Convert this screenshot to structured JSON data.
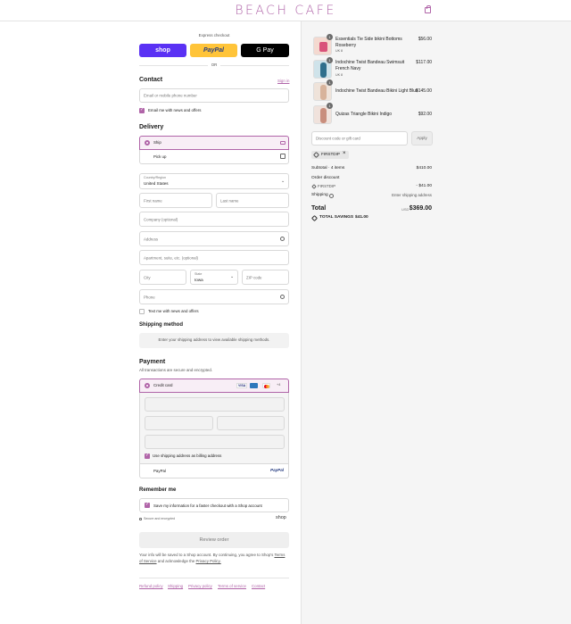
{
  "header": {
    "brand": "BEACH CAFE",
    "cart_icon": "shopping-bag-icon"
  },
  "express": {
    "label": "Express checkout",
    "shop_label": "shop",
    "paypal_label": "PayPal",
    "gpay_label": "G Pay",
    "or_label": "OR"
  },
  "contact": {
    "title": "Contact",
    "sign_in": "Sign in",
    "email_placeholder": "Email or mobile phone number",
    "news_label": "Email me with news and offers"
  },
  "delivery": {
    "title": "Delivery",
    "ship_label": "Ship",
    "pickup_label": "Pick up",
    "country_label": "Country/Region",
    "country_value": "United States",
    "first_name": "First name",
    "last_name": "Last name",
    "company": "Company (optional)",
    "address": "Address",
    "apartment": "Apartment, suite, etc. (optional)",
    "city": "City",
    "state_label": "State",
    "state_value": "Iowa",
    "zip": "ZIP code",
    "phone": "Phone",
    "text_label": "Text me with news and offers"
  },
  "shipping_method": {
    "title": "Shipping method",
    "notice": "Enter your shipping address to view available shipping methods."
  },
  "payment": {
    "title": "Payment",
    "subtitle": "All transactions are secure and encrypted.",
    "credit_card": "Credit card",
    "visa": "VISA",
    "more": "+4",
    "billing_label": "Use shipping address as billing address",
    "paypal_label": "PayPal"
  },
  "remember": {
    "title": "Remember me",
    "save_label": "Save my information for a faster checkout with a Shop account",
    "secure": "Secure and encrypted",
    "shop": "shop"
  },
  "review_button": "Review order",
  "consent": {
    "line1": "Your info will be saved to a Shop account. By continuing, you agree to Shop's",
    "terms": "Terms of Service",
    "and": "and acknowledge the",
    "privacy": "Privacy Policy."
  },
  "footer": [
    "Refund policy",
    "Shipping",
    "Privacy policy",
    "Terms of service",
    "Contact"
  ],
  "cart": {
    "items": [
      {
        "qty": "1",
        "name": "Essentials Tie Side bikini Bottoms Roseberry",
        "variant": "UK 8",
        "price": "$56.00"
      },
      {
        "qty": "1",
        "name": "Indochine Twist Bandeau Swimsuit French Navy",
        "variant": "UK 8",
        "price": "$117.00"
      },
      {
        "qty": "1",
        "name": "Indochine Twist Bandeau Bikini Light Blue",
        "variant": "",
        "price": "$145.00"
      },
      {
        "qty": "1",
        "name": "Quizas Triangle Bikini Indigo",
        "variant": "",
        "price": "$92.00"
      }
    ],
    "discount_placeholder": "Discount code or gift card",
    "apply": "Apply",
    "code_chip": "FIRSTDIP",
    "subtotal_label": "Subtotal · 4 items",
    "subtotal_value": "$410.00",
    "order_discount_label": "Order discount",
    "order_discount_code": "FIRSTDIP",
    "order_discount_value": "- $41.00",
    "shipping_label": "Shipping",
    "shipping_value": "Enter shipping address",
    "total_label": "Total",
    "currency": "USD",
    "total_value": "$369.00",
    "savings_label": "TOTAL SAVINGS",
    "savings_value": "$41.00"
  },
  "colors": {
    "accent": "#b064a8",
    "shop": "#5a31f4",
    "paypal": "#ffc439",
    "sidebar_bg": "#f5f5f5"
  }
}
